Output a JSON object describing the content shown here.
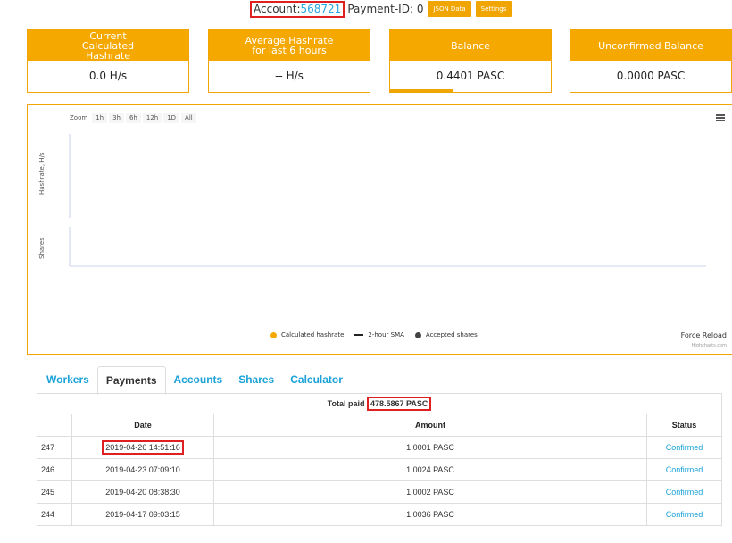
{
  "top": {
    "account_label": "Account:",
    "account_id": "568721",
    "payment_id": "Payment-ID: 0",
    "json_btn": "JSON Data",
    "settings_btn": "Settings"
  },
  "cards": [
    {
      "title": "Current Calculated Hashrate",
      "value": "0.0 H/s"
    },
    {
      "title": "Average Hashrate for last 6 hours",
      "value": "-- H/s"
    },
    {
      "title": "Balance",
      "value": "0.4401 PASC"
    },
    {
      "title": "Unconfirmed Balance",
      "value": "0.0000 PASC"
    }
  ],
  "chart": {
    "zoom_label": "Zoom",
    "zoom_buttons": [
      "1h",
      "3h",
      "6h",
      "12h",
      "1D",
      "All"
    ],
    "y_label_top": "Hashrate, H/s",
    "y_label_bottom": "Shares",
    "legend": [
      "Calculated hashrate",
      "2-hour SMA",
      "Accepted shares"
    ],
    "force_reload": "Force Reload",
    "credits": "Highcharts.com",
    "colors": {
      "hashrate": "#f4a800",
      "sma": "#222222",
      "shares": "#444444",
      "accent": "#f0a500"
    }
  },
  "tabs": [
    "Workers",
    "Payments",
    "Accounts",
    "Shares",
    "Calculator"
  ],
  "payments": {
    "total_label": "Total paid",
    "total_value": "478.5867 PASC",
    "headers": [
      "",
      "Date",
      "Amount",
      "Status"
    ],
    "rows": [
      {
        "id": "247",
        "date": "2019-04-26 14:51:16",
        "amount": "1.0001 PASC",
        "status": "Confirmed"
      },
      {
        "id": "246",
        "date": "2019-04-23 07:09:10",
        "amount": "1.0024 PASC",
        "status": "Confirmed"
      },
      {
        "id": "245",
        "date": "2019-04-20 08:38:30",
        "amount": "1.0002 PASC",
        "status": "Confirmed"
      },
      {
        "id": "244",
        "date": "2019-04-17 09:03:15",
        "amount": "1.0036 PASC",
        "status": "Confirmed"
      }
    ]
  }
}
